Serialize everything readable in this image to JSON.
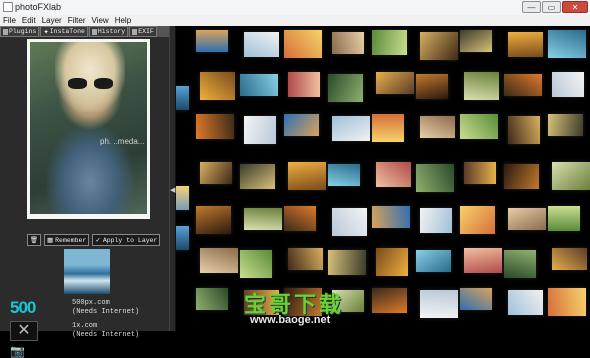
{
  "window": {
    "title": "photoFXlab",
    "buttons": {
      "minimize": "—",
      "maximize": "▭",
      "close": "✕"
    }
  },
  "menu": [
    "File",
    "Edit",
    "Layer",
    "Filter",
    "View",
    "Help"
  ],
  "tabs": [
    {
      "label": "Plugins",
      "icon": "puzzle-icon"
    },
    {
      "label": "InstaTone",
      "icon": "star-icon"
    },
    {
      "label": "History",
      "icon": "history-icon"
    },
    {
      "label": "EXIF",
      "icon": "exif-icon"
    }
  ],
  "preview": {
    "watermark": "ph. ..meda..."
  },
  "toolbar": {
    "delete_icon": "trash-icon",
    "remember_label": "Remember",
    "apply_label": "Apply to Layer"
  },
  "plugins": [
    {
      "logo": "500",
      "name": "500px.com",
      "note": "(Needs Internet)"
    },
    {
      "logo": "✕",
      "name": "1x.com",
      "note": "(Needs Internet)"
    }
  ],
  "watermark": {
    "text": "宝哥下载",
    "url": "www.baoge.net"
  },
  "colors": {
    "accent_green": "#6ad12e",
    "teal_500px": "#18c6d8",
    "panel": "#2b2b2b"
  }
}
